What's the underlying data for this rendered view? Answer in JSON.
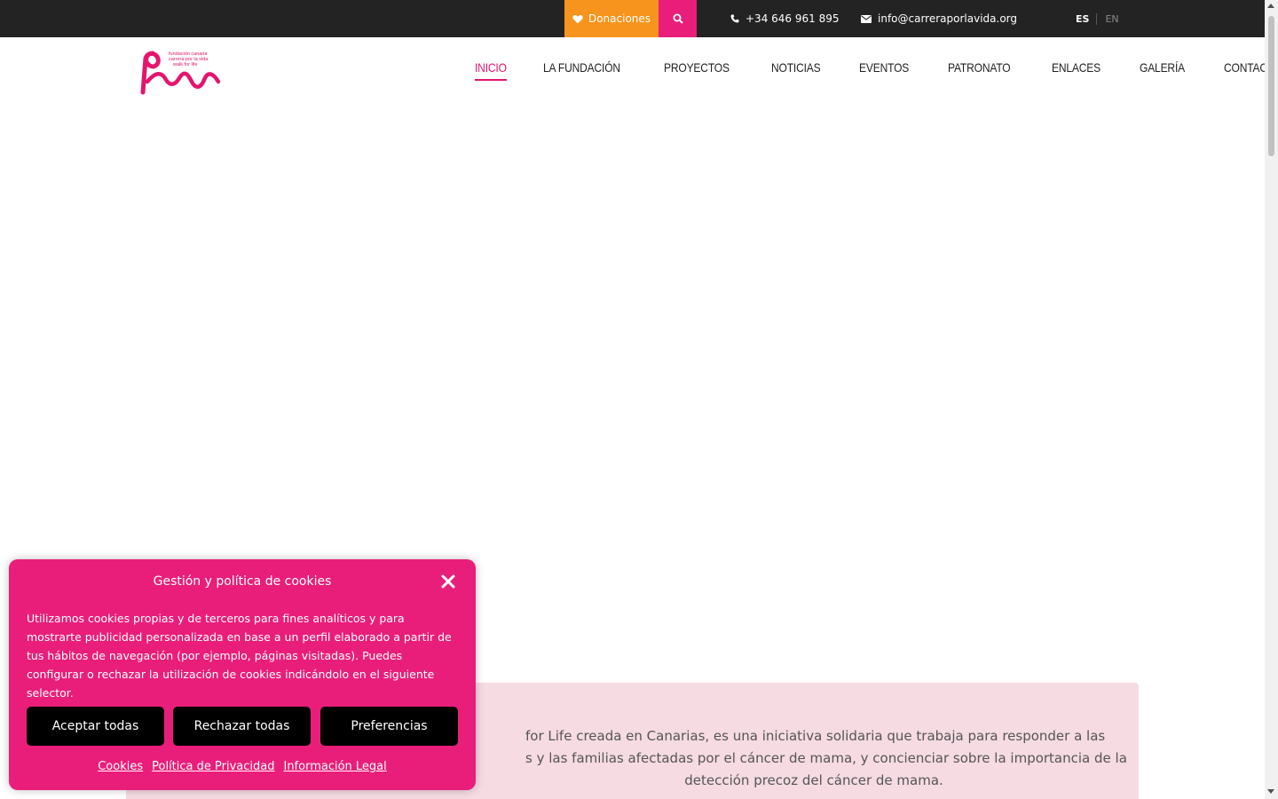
{
  "topbar": {
    "donate_label": "Donaciones",
    "phone": "+34 646 961 895",
    "email": "info@carreraporlavida.org",
    "lang_es": "ES",
    "lang_en": "EN"
  },
  "logo": {
    "line1": "fundación canaria",
    "line2": "carrera por la vida",
    "line3": "walk for life"
  },
  "nav": {
    "items": [
      "INICIO",
      "LA FUNDACIÓN",
      "PROYECTOS",
      "NOTICIAS",
      "EVENTOS",
      "PATRONATO",
      "ENLACES",
      "GALERÍA",
      "CONTACTO"
    ],
    "active": "INICIO"
  },
  "intro": {
    "line1": "for Life creada en Canarias, es una iniciativa solidaria que trabaja para responder a las",
    "line2": "s y las familias afectadas por el cáncer de mama, y concienciar sobre la importancia de la",
    "line3": "detección precoz del cáncer de mama."
  },
  "cookie": {
    "title": "Gestión y política de cookies",
    "text": "Utilizamos cookies propias y de terceros para fines analíticos y para mostrarte publicidad personalizada en base a un perfil elaborado a partir de tus hábitos de navegación (por ejemplo, páginas visitadas). Puedes configurar o rechazar la utilización de cookies indicándolo en el siguiente selector.",
    "accept_label": "Aceptar todas",
    "reject_label": "Rechazar todas",
    "prefs_label": "Preferencias",
    "links": [
      "Cookies",
      "Política de Privacidad",
      "Información Legal"
    ]
  },
  "colors": {
    "brand_pink": "#e91e7a",
    "donate_orange": "#f7941d",
    "topbar_bg": "#232323",
    "intro_bg": "#f6dbe3"
  },
  "icons": [
    "heart-icon",
    "search-icon",
    "phone-icon",
    "envelope-icon",
    "close-icon"
  ]
}
